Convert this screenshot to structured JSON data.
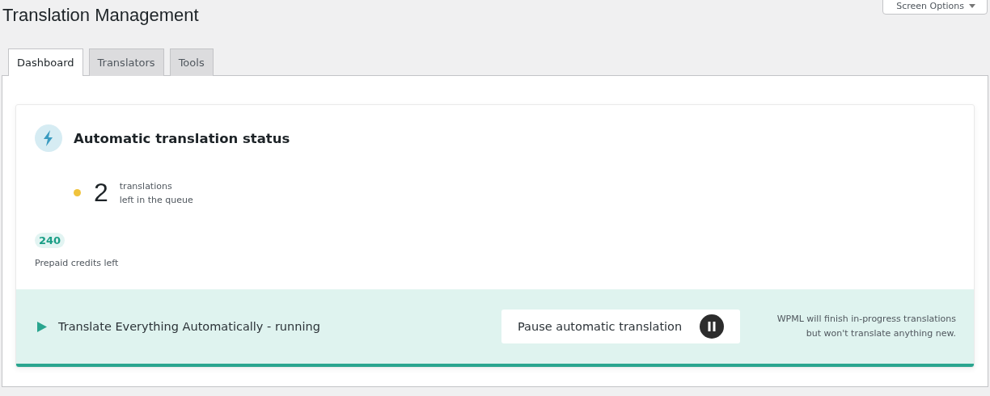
{
  "page_title": "Translation Management",
  "screen_options": {
    "label": "Screen Options"
  },
  "tabs": [
    {
      "label": "Dashboard",
      "selected": true
    },
    {
      "label": "Translators",
      "selected": false
    },
    {
      "label": "Tools",
      "selected": false
    }
  ],
  "status_card": {
    "title": "Automatic translation status",
    "queue": {
      "count": "2",
      "line_1": "translations",
      "line_2": "left in the queue",
      "color": "#f0c33c"
    },
    "credits": {
      "amount": "240",
      "label": "Prepaid credits left"
    },
    "footer": {
      "running": true,
      "status": "Translate Everything Automatically - running",
      "button": "Pause automatic translation",
      "note": "WPML will finish in-progress translations but won't translate anything new."
    }
  }
}
